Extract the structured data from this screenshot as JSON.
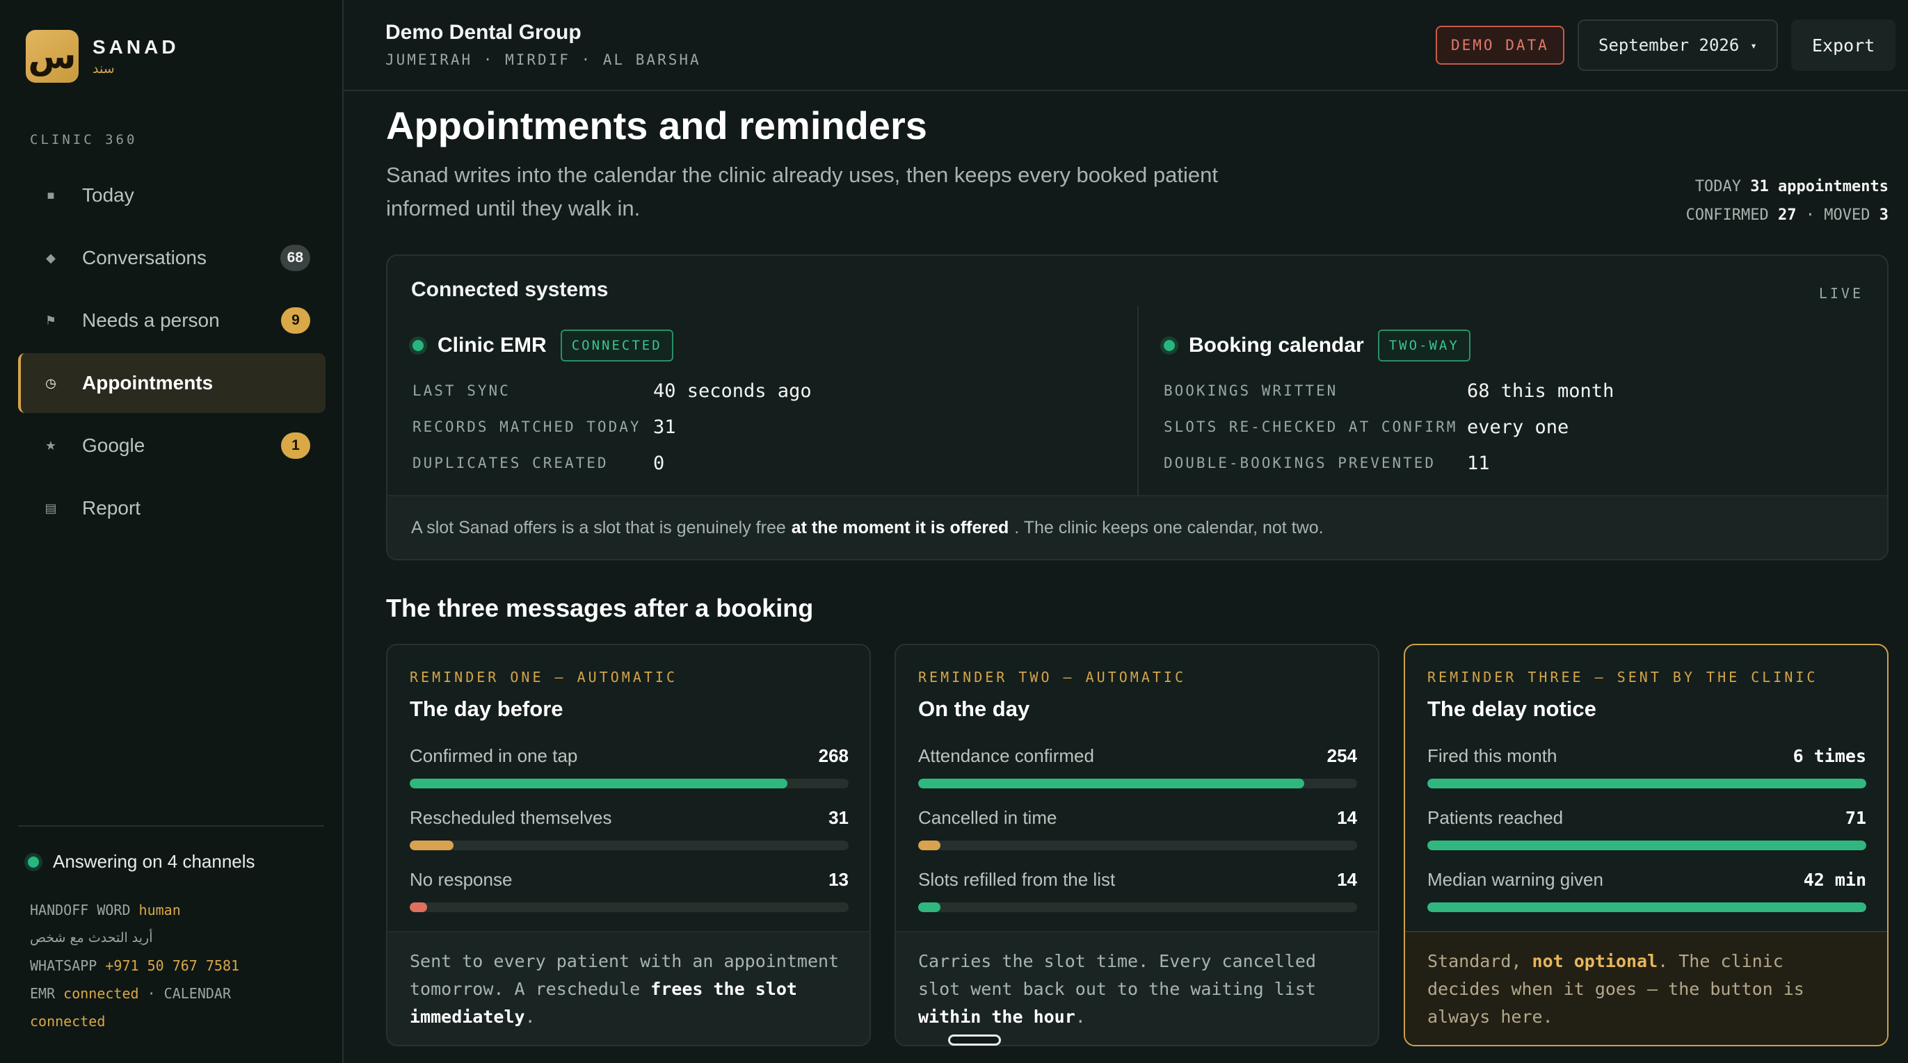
{
  "brand": {
    "logo_glyph": "س",
    "name": "SANAD",
    "name_ar": "سند"
  },
  "sidebar": {
    "section": "CLINIC 360",
    "items": [
      {
        "label": "Today",
        "icon": "square-icon",
        "glyph": "■",
        "badge": ""
      },
      {
        "label": "Conversations",
        "icon": "diamond-icon",
        "glyph": "◆",
        "badge": "68"
      },
      {
        "label": "Needs a person",
        "icon": "flag-icon",
        "glyph": "⚑",
        "badge": "9"
      },
      {
        "label": "Appointments",
        "icon": "clock-icon",
        "glyph": "◷",
        "badge": ""
      },
      {
        "label": "Google",
        "icon": "star-icon",
        "glyph": "★",
        "badge": "1"
      },
      {
        "label": "Report",
        "icon": "report-icon",
        "glyph": "▤",
        "badge": ""
      }
    ],
    "status": "Answering on 4 channels",
    "handoff_label": "HANDOFF WORD",
    "handoff_word": "human",
    "handoff_ar": "أريد التحدث مع شخص",
    "whatsapp_label": "WHATSAPP",
    "whatsapp_number": "+971 50 767 7581",
    "emr_label": "EMR",
    "emr_status": "connected",
    "calendar_label": "· CALENDAR",
    "calendar_status": "connected"
  },
  "header": {
    "org_name": "Demo Dental Group",
    "org_locations": "JUMEIRAH · MIRDIF · AL BARSHA",
    "demo_badge": "DEMO DATA",
    "month": "September 2026",
    "export_label": "Export"
  },
  "page": {
    "title": "Appointments and reminders",
    "description": "Sanad writes into the calendar the clinic already uses, then keeps every booked patient informed until they walk in.",
    "today_label": "TODAY",
    "today_value": "31",
    "today_unit": "appointments",
    "confirmed_label": "CONFIRMED",
    "confirmed_value": "27",
    "moved_label": "· MOVED",
    "moved_value": "3"
  },
  "systems": {
    "title": "Connected systems",
    "live": "LIVE",
    "emr": {
      "name": "Clinic EMR",
      "tag": "CONNECTED",
      "rows": [
        {
          "k": "LAST SYNC",
          "v": "40 seconds ago"
        },
        {
          "k": "RECORDS MATCHED TODAY",
          "v": "31"
        },
        {
          "k": "DUPLICATES CREATED",
          "v": "0"
        }
      ]
    },
    "calendar": {
      "name": "Booking calendar",
      "tag": "TWO-WAY",
      "rows": [
        {
          "k": "BOOKINGS WRITTEN",
          "v": "68 this month"
        },
        {
          "k": "SLOTS RE-CHECKED AT CONFIRM",
          "v": "every one"
        },
        {
          "k": "DOUBLE-BOOKINGS PREVENTED",
          "v": "11"
        }
      ]
    },
    "footer_pre": "A slot Sanad offers is a slot that is genuinely free",
    "footer_bold": "at the moment it is offered",
    "footer_post": ". The clinic keeps one calendar, not two."
  },
  "messages": {
    "title": "The three messages after a booking",
    "cards": [
      {
        "eyebrow": "REMINDER ONE — AUTOMATIC",
        "title": "The day before",
        "rows": [
          {
            "label": "Confirmed in one tap",
            "value": "268",
            "fill": 0.86,
            "color": "green"
          },
          {
            "label": "Rescheduled themselves",
            "value": "31",
            "fill": 0.1,
            "color": "amber"
          },
          {
            "label": "No response",
            "value": "13",
            "fill": 0.04,
            "color": "red"
          }
        ],
        "foot_pre": "Sent to every patient with an appointment tomorrow. A reschedule",
        "foot_bold": "frees the slot immediately",
        "foot_post": "."
      },
      {
        "eyebrow": "REMINDER TWO — AUTOMATIC",
        "title": "On the day",
        "rows": [
          {
            "label": "Attendance confirmed",
            "value": "254",
            "fill": 0.88,
            "color": "green"
          },
          {
            "label": "Cancelled in time",
            "value": "14",
            "fill": 0.05,
            "color": "amber"
          },
          {
            "label": "Slots refilled from the list",
            "value": "14",
            "fill": 0.05,
            "color": "green"
          }
        ],
        "foot_pre": "Carries the slot time. Every cancelled slot went back out to the waiting list",
        "foot_bold": "within the hour",
        "foot_post": "."
      },
      {
        "eyebrow": "REMINDER THREE — SENT BY THE CLINIC",
        "title": "The delay notice",
        "rows": [
          {
            "label": "Fired this month",
            "value": "6 times",
            "fill": 1.0,
            "color": "green"
          },
          {
            "label": "Patients reached",
            "value": "71",
            "fill": 1.0,
            "color": "green"
          },
          {
            "label": "Median warning given",
            "value": "42 min",
            "fill": 1.0,
            "color": "green"
          }
        ],
        "foot_pre": "Standard,",
        "foot_bold": "not optional",
        "foot_post": ". The clinic decides when it goes — the button is always here."
      }
    ]
  },
  "colors": {
    "accent_gold": "#d3a54b",
    "status_green": "#2fb77f",
    "warning_amber": "#d9a24f",
    "alert_red": "#e0705e"
  }
}
